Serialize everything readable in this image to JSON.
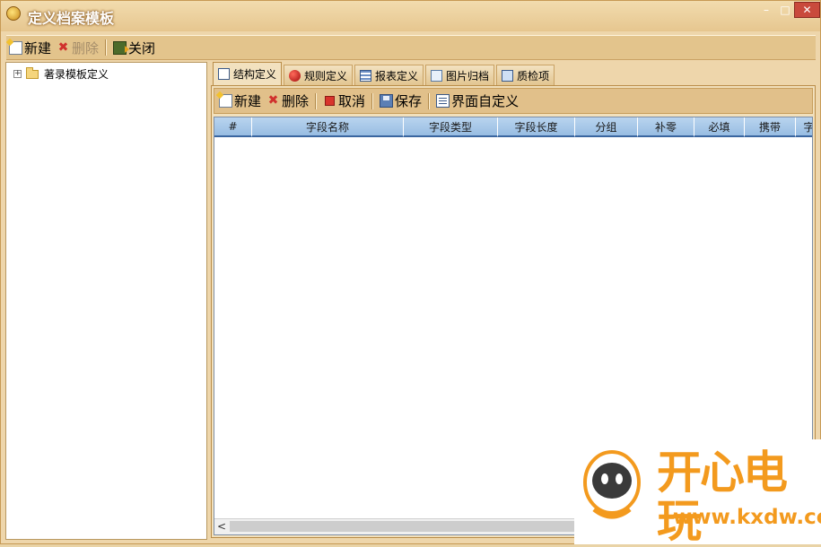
{
  "window": {
    "title": "定义档案模板",
    "min_glyph": "–",
    "max_glyph": "□",
    "close_glyph": "✕"
  },
  "toolbar": {
    "new": "新建",
    "delete": "删除",
    "close": "关闭"
  },
  "tree": {
    "expander": "+",
    "root": "著录模板定义"
  },
  "tabs": [
    {
      "label": "结构定义",
      "icon": "table-icon"
    },
    {
      "label": "规则定义",
      "icon": "apple-icon"
    },
    {
      "label": "报表定义",
      "icon": "report-icon"
    },
    {
      "label": "图片归档",
      "icon": "image-icon"
    },
    {
      "label": "质检项",
      "icon": "check-icon"
    }
  ],
  "subtoolbar": {
    "new": "新建",
    "delete": "删除",
    "cancel": "取消",
    "save": "保存",
    "customize": "界面自定义"
  },
  "grid": {
    "columns": [
      "#",
      "字段名称",
      "字段类型",
      "字段长度",
      "分组",
      "补零",
      "必填",
      "携带",
      "字"
    ],
    "rows": [],
    "scroll_left_glyph": "<"
  },
  "watermark": {
    "brand": "开心电玩",
    "url": "www.kxdw.com"
  },
  "colors": {
    "chrome": "#eed6ab",
    "header": "#a9c9ea",
    "close": "#c94a3c",
    "brand": "#f39a1e"
  }
}
